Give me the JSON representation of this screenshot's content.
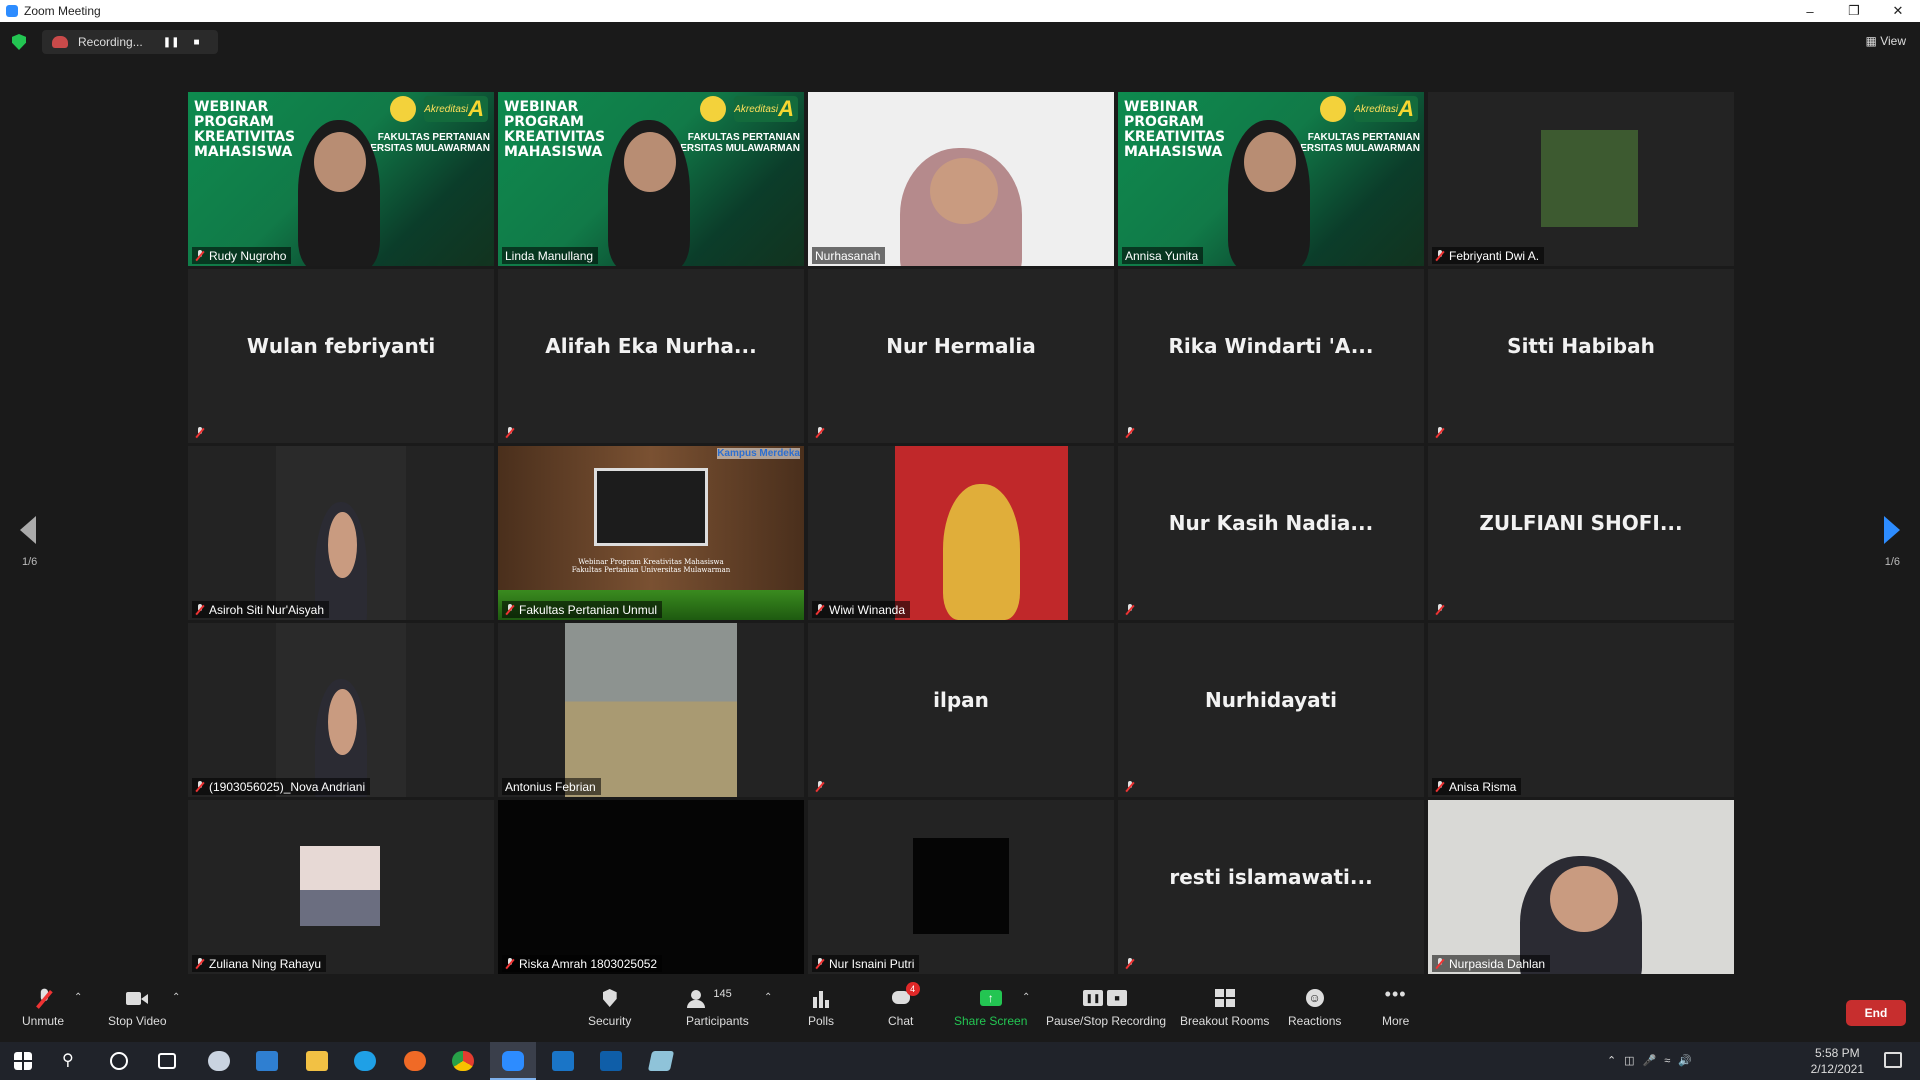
{
  "window": {
    "title": "Zoom Meeting"
  },
  "recording": {
    "label": "Recording..."
  },
  "view": {
    "label": "View"
  },
  "paging": {
    "left": "1/6",
    "right": "1/6"
  },
  "tiles": [
    {
      "name": "Rudy Nugroho",
      "kind": "webinar",
      "muted": true
    },
    {
      "name": "Linda Manullang",
      "kind": "webinar",
      "muted": false
    },
    {
      "name": "Nurhasanah",
      "kind": "video",
      "muted": false
    },
    {
      "name": "Annisa Yunita",
      "kind": "webinar",
      "muted": false,
      "active": true
    },
    {
      "name": "Febriyanti Dwi A.",
      "kind": "photo",
      "muted": true
    },
    {
      "name": "Wulan febriyanti",
      "kind": "name",
      "muted": true
    },
    {
      "name": "Alifah Eka Nurha...",
      "kind": "name",
      "muted": true
    },
    {
      "name": "Nur Hermalia",
      "kind": "name",
      "muted": true
    },
    {
      "name": "Rika Windarti 'A...",
      "kind": "name",
      "muted": true
    },
    {
      "name": "Sitti Habibah",
      "kind": "name",
      "muted": true
    },
    {
      "name": "Asiroh Siti Nur'Aisyah",
      "kind": "video",
      "muted": true
    },
    {
      "name": "Fakultas Pertanian Unmul",
      "kind": "slide",
      "muted": true
    },
    {
      "name": "Wiwi Winanda",
      "kind": "photo",
      "muted": true
    },
    {
      "name": "Nur Kasih Nadia...",
      "kind": "name",
      "muted": true
    },
    {
      "name": "ZULFIANI SHOFI...",
      "kind": "name",
      "muted": true
    },
    {
      "name": "(1903056025)_Nova Andriani",
      "kind": "video",
      "muted": true
    },
    {
      "name": "Antonius Febrian",
      "kind": "photo",
      "muted": false
    },
    {
      "name": "ilpan",
      "kind": "name",
      "muted": true
    },
    {
      "name": "Nurhidayati",
      "kind": "name",
      "muted": true
    },
    {
      "name": "Anisa Risma",
      "kind": "blank",
      "muted": true
    },
    {
      "name": "Zuliana Ning Rahayu",
      "kind": "photo",
      "muted": true
    },
    {
      "name": "Riska Amrah 1803025052",
      "kind": "black",
      "muted": true
    },
    {
      "name": "Nur Isnaini Putri",
      "kind": "photo",
      "muted": true
    },
    {
      "name": "resti islamawati...",
      "kind": "name",
      "muted": true
    },
    {
      "name": "Nurpasida Dahlan",
      "kind": "video",
      "muted": true
    }
  ],
  "webinar_banner": {
    "text": "WEBINAR\nPROGRAM\nKREATIVITAS\nMAHASISWA",
    "faculty": "FAKULTAS PERTANIAN\nUNIVERSITAS MULAWARMAN",
    "akreditasi": "Akreditasi",
    "grade": "A"
  },
  "slide": {
    "caption": "Webinar Program Kreativitas Mahasiswa\nFakultas Pertanian Universitas Mulawarman",
    "badge": "Kampus Merdeka"
  },
  "toolbar": {
    "unmute": "Unmute",
    "stop_video": "Stop Video",
    "security": "Security",
    "participants": "Participants",
    "participants_count": "145",
    "polls": "Polls",
    "chat": "Chat",
    "chat_badge": "4",
    "share_screen": "Share Screen",
    "pause_stop_recording": "Pause/Stop Recording",
    "breakout_rooms": "Breakout Rooms",
    "reactions": "Reactions",
    "more": "More",
    "end": "End"
  },
  "clock": {
    "time": "5:58 PM",
    "date": "2/12/2021"
  },
  "colors": {
    "accent": "#2d8cff",
    "share": "#23c552",
    "end": "#c72e2e",
    "active_speaker": "#f0e85f"
  }
}
